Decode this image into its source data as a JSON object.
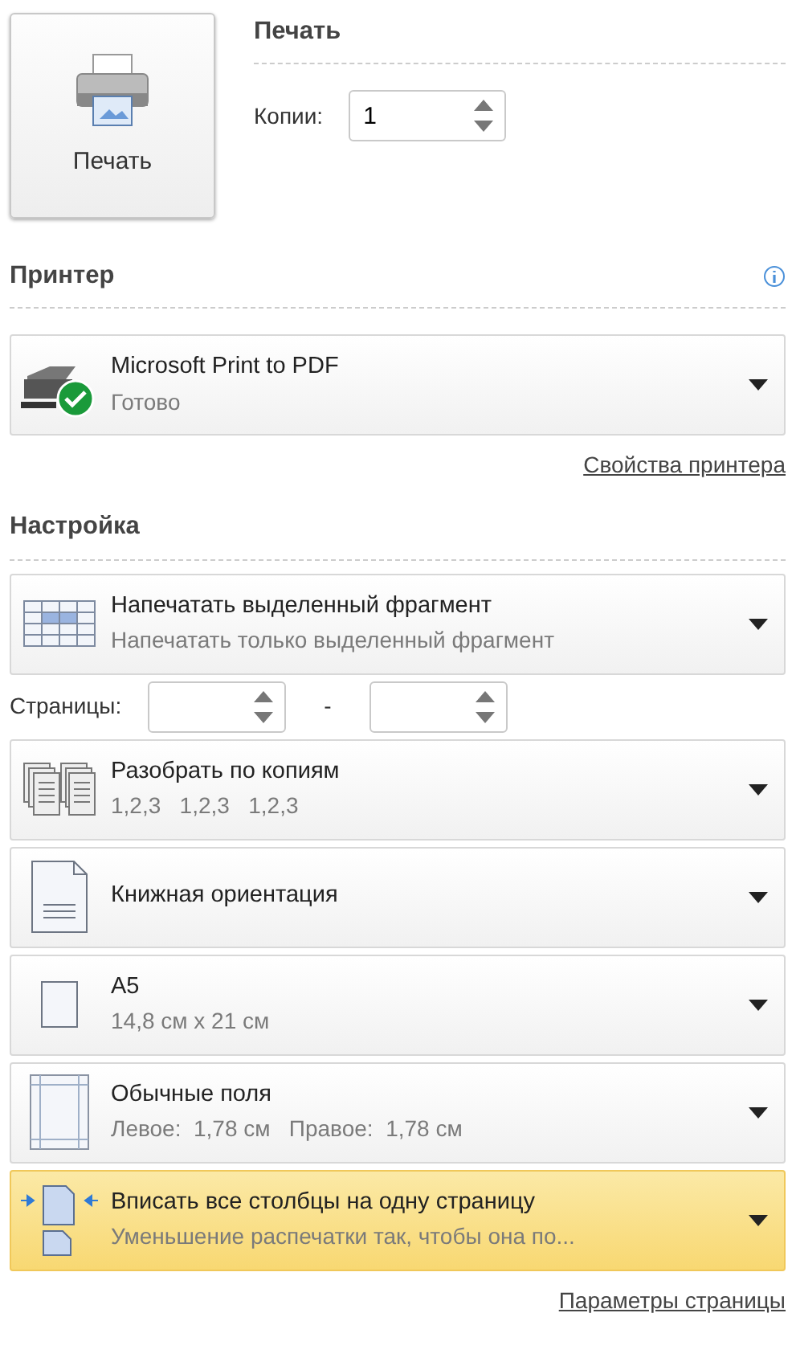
{
  "print_button": {
    "label": "Печать"
  },
  "print_section": {
    "title": "Печать",
    "copies_label": "Копии:",
    "copies_value": "1"
  },
  "printer_section": {
    "title": "Принтер",
    "printer": {
      "name": "Microsoft Print to PDF",
      "status": "Готово",
      "ready": true
    },
    "properties_link": "Свойства принтера"
  },
  "settings_section": {
    "title": "Настройка",
    "print_range": {
      "kind": "selection",
      "title": "Напечатать выделенный фрагмент",
      "subtitle": "Напечатать только выделенный фрагмент",
      "highlighted": false
    },
    "pages": {
      "label": "Страницы:",
      "separator": "-"
    },
    "options": [
      {
        "kind": "collate",
        "title": "Разобрать по копиям",
        "subtitle": "1,2,3   1,2,3   1,2,3",
        "highlighted": false
      },
      {
        "kind": "orientation",
        "title": "Книжная ориентация",
        "highlighted": false
      },
      {
        "kind": "paper",
        "title": "A5",
        "subtitle": "14,8 см x 21 см",
        "highlighted": false
      },
      {
        "kind": "margins",
        "title": "Обычные поля",
        "subtitle": "Левое:  1,78 см   Правое:  1,78 см",
        "highlighted": false
      },
      {
        "kind": "scaling",
        "title": "Вписать все столбцы на одну страницу",
        "subtitle": "Уменьшение распечатки так, чтобы она по...",
        "highlighted": true
      }
    ],
    "page_setup_link": "Параметры страницы"
  }
}
